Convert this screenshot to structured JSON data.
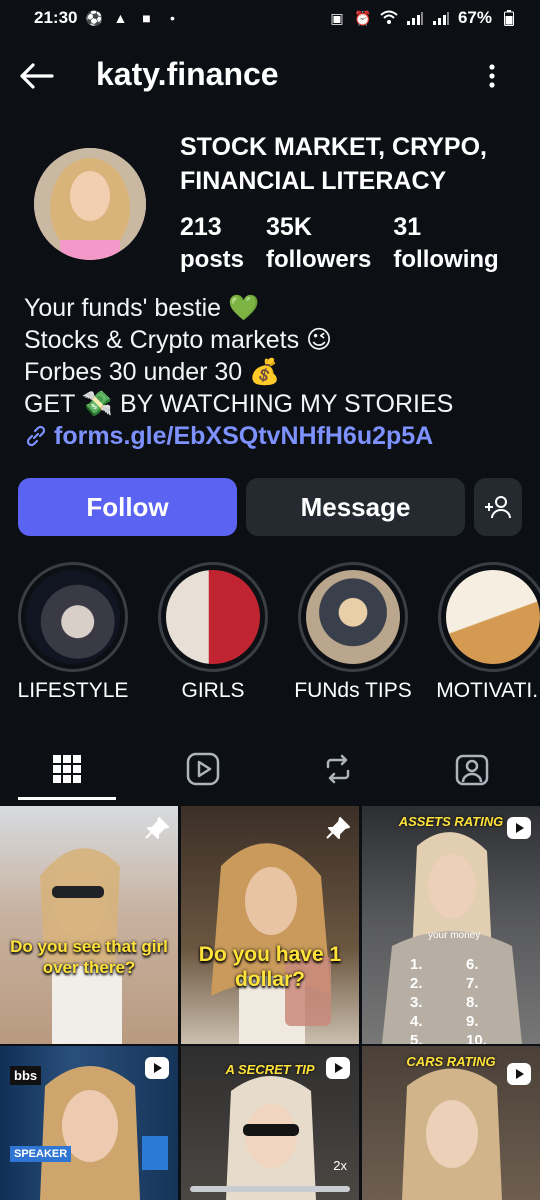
{
  "status_bar": {
    "time": "21:30",
    "battery": "67%"
  },
  "header": {
    "username": "katy.finance"
  },
  "profile": {
    "category_title": "STOCK MARKET, CRYPO, FINANCIAL LITERACY",
    "posts_count": "213",
    "posts_label": "posts",
    "followers_count": "35K",
    "followers_label": "followers",
    "following_count": "31",
    "following_label": "following",
    "bio_lines": [
      "Your funds' bestie 💚",
      "Stocks & Crypto markets 😉",
      "Forbes 30 under 30 💰",
      "GET 💸 BY WATCHING MY STORIES"
    ],
    "link": "forms.gle/EbXSQtvNHfH6u2p5A"
  },
  "actions": {
    "follow_label": "Follow",
    "message_label": "Message"
  },
  "highlights": [
    {
      "label": "LIFESTYLE",
      "colors": [
        "#1b1f2a",
        "#cfc7bf"
      ]
    },
    {
      "label": "GIRLS",
      "colors": [
        "#e9e2d8",
        "#c0202c"
      ]
    },
    {
      "label": "FUNds TIPS",
      "colors": [
        "#c9b79c",
        "#3a3f4c"
      ]
    },
    {
      "label": "MOTIVATI...",
      "colors": [
        "#f6efe1",
        "#d9a35a"
      ]
    }
  ],
  "tabs": [
    {
      "name": "grid-icon",
      "active": true
    },
    {
      "name": "reels-icon",
      "active": false
    },
    {
      "name": "reposts-icon",
      "active": false
    },
    {
      "name": "tagged-icon",
      "active": false
    }
  ],
  "posts": [
    {
      "caption": "Do you see that girl over there?",
      "badge": "pin-icon",
      "colors": [
        "#d9dde3",
        "#caa587"
      ]
    },
    {
      "caption": "Do you have 1 dollar?",
      "badge": "pin-icon",
      "colors": [
        "#4b3a2d",
        "#c9a06a"
      ]
    },
    {
      "top_label": "ASSETS RATING",
      "badge": "reel-badge-icon",
      "rating_title": "your money",
      "rating_items": [
        "1.",
        "6.",
        "2.",
        "7.",
        "3.",
        "8.",
        "4.",
        "9.",
        "5.",
        "10."
      ],
      "colors": [
        "#2e3034",
        "#d6c1a6"
      ]
    },
    {
      "side_text": "bbs",
      "side_text2": "SPEAKER",
      "badge": "reel-badge-icon",
      "colors": [
        "#123a66",
        "#d8b07c"
      ]
    },
    {
      "top_label": "A SECRET TIP",
      "badge": "reel-badge-icon",
      "corner_text": "2x",
      "colors": [
        "#2b2b2b",
        "#cfc2b3"
      ]
    },
    {
      "top_label": "CARS RATING",
      "badge": "reel-badge-icon",
      "colors": [
        "#4a4038",
        "#d7b79a"
      ]
    }
  ]
}
